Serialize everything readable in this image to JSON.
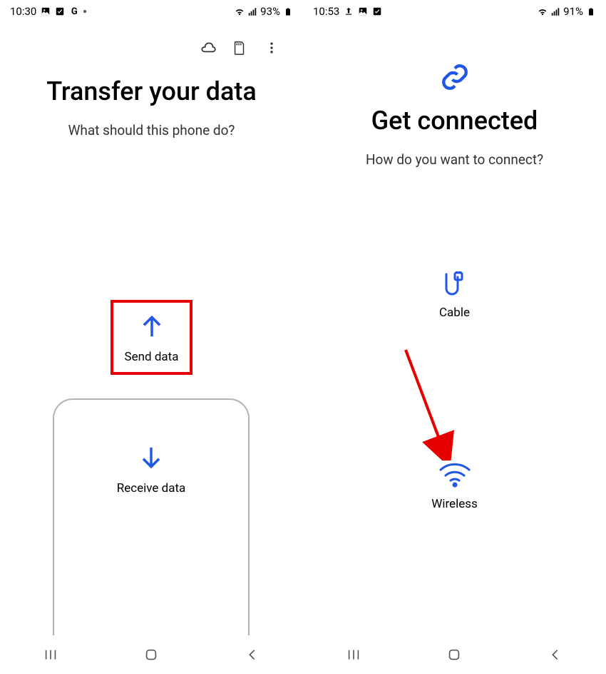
{
  "screen1": {
    "status": {
      "time": "10:30",
      "battery": "93%"
    },
    "title": "Transfer your data",
    "subtitle": "What should this phone do?",
    "send_label": "Send data",
    "receive_label": "Receive data"
  },
  "screen2": {
    "status": {
      "time": "10:53",
      "battery": "91%"
    },
    "title": "Get connected",
    "subtitle": "How do you want to connect?",
    "cable_label": "Cable",
    "wireless_label": "Wireless"
  }
}
